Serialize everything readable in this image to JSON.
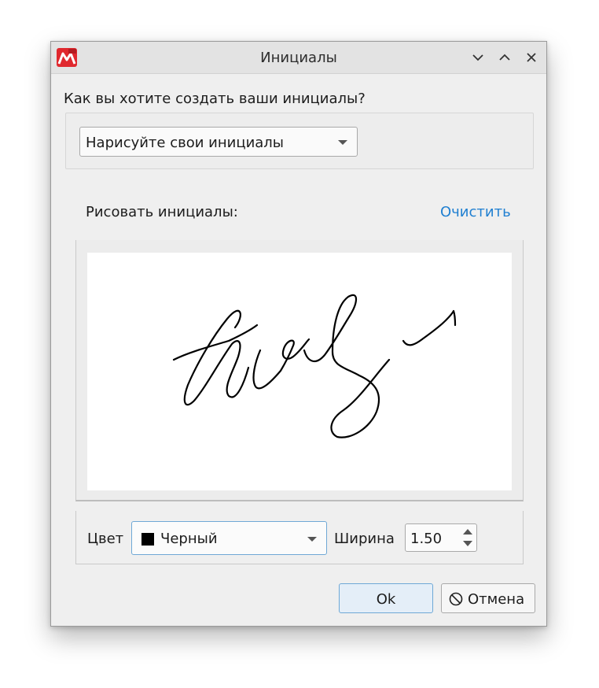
{
  "window": {
    "title": "Инициалы",
    "app_icon": "app-pdf-icon",
    "controls": [
      "minimize-icon",
      "maximize-icon",
      "close-icon"
    ]
  },
  "method": {
    "question": "Как вы хотите создать ваши инициалы?",
    "selected": "Нарисуйте свои инициалы"
  },
  "draw": {
    "label": "Рисовать инициалы:",
    "clear_label": "Очистить"
  },
  "options": {
    "color_label": "Цвет",
    "color_value": "Черный",
    "color_swatch": "#000000",
    "width_label": "Ширина",
    "width_value": "1.50"
  },
  "buttons": {
    "ok": "Ok",
    "cancel": "Отмена"
  },
  "colors": {
    "link": "#1f7fd1",
    "focus_border": "#6fa8d6",
    "app_icon_red": "#e0282e"
  }
}
